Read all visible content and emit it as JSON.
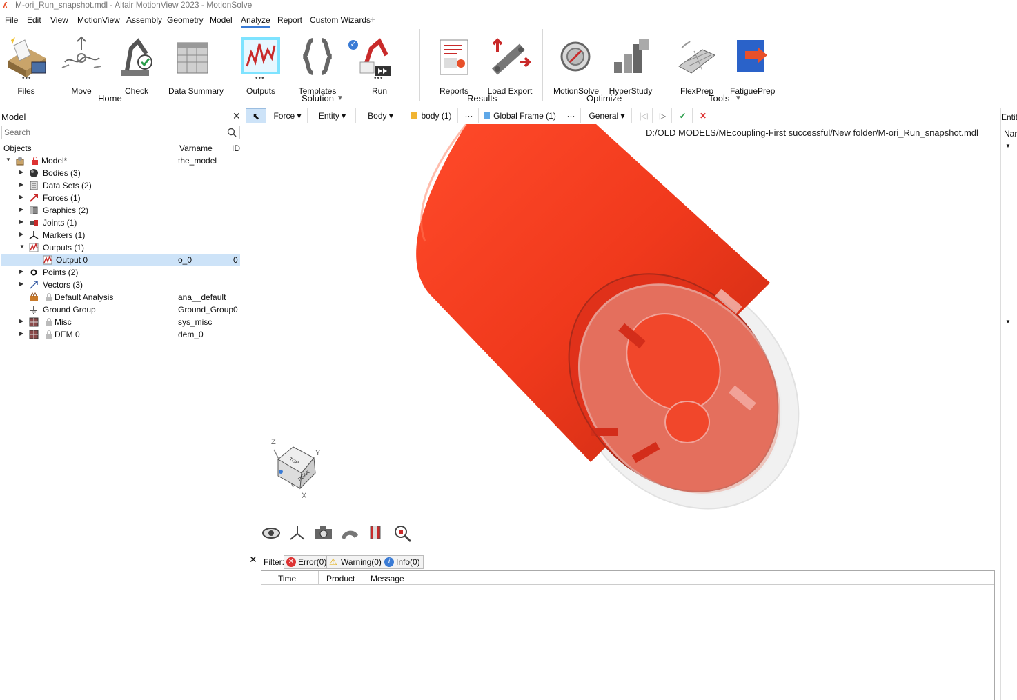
{
  "window": {
    "title": "M-ori_Run_snapshot.mdl - Altair MotionView 2023 - MotionSolve"
  },
  "menu": [
    "File",
    "Edit",
    "View",
    "MotionView",
    "Assembly",
    "Geometry",
    "Model",
    "Analyze",
    "Report",
    "Custom Wizards"
  ],
  "menu_active": "Analyze",
  "ribbon": {
    "tools": [
      "Files",
      "Move",
      "Check",
      "Data Summary",
      "Outputs",
      "Templates",
      "Run",
      "Reports",
      "Load Export",
      "MotionSolve",
      "HyperStudy",
      "FlexPrep",
      "FatiguePrep"
    ],
    "groups": [
      "Home",
      "Solution",
      "Results",
      "Optimize",
      "Tools"
    ]
  },
  "panel": {
    "title": "Model",
    "search_placeholder": "Search",
    "columns": [
      "Objects",
      "Varname",
      "ID"
    ],
    "rows": [
      {
        "name": "Model*",
        "varname": "the_model",
        "id": ""
      },
      {
        "name": "Bodies  (3)",
        "varname": "",
        "id": ""
      },
      {
        "name": "Data Sets  (2)",
        "varname": "",
        "id": ""
      },
      {
        "name": "Forces  (1)",
        "varname": "",
        "id": ""
      },
      {
        "name": "Graphics  (2)",
        "varname": "",
        "id": ""
      },
      {
        "name": "Joints  (1)",
        "varname": "",
        "id": ""
      },
      {
        "name": "Markers  (1)",
        "varname": "",
        "id": ""
      },
      {
        "name": "Outputs  (1)",
        "varname": "",
        "id": ""
      },
      {
        "name": "Output 0",
        "varname": "o_0",
        "id": "0"
      },
      {
        "name": "Points  (2)",
        "varname": "",
        "id": ""
      },
      {
        "name": "Vectors  (3)",
        "varname": "",
        "id": ""
      },
      {
        "name": "Default Analysis",
        "varname": "ana__default",
        "id": ""
      },
      {
        "name": "Ground Group",
        "varname": "Ground_Group",
        "id": "0"
      },
      {
        "name": "Misc",
        "varname": "sys_misc",
        "id": ""
      },
      {
        "name": "DEM 0",
        "varname": "dem_0",
        "id": ""
      }
    ]
  },
  "entity_toolbar": {
    "force": "Force",
    "entity": "Entity",
    "body": "Body",
    "body_value": "body (1)",
    "more1": "···",
    "frame_value": "Global Frame (1)",
    "more2": "···",
    "general": "General"
  },
  "viewport": {
    "filepath": "D:/OLD MODELS/MEcoupling-First successful/New folder/M-ori_Run_snapshot.mdl",
    "triad": {
      "z": "Z",
      "y": "Y",
      "x": "X"
    },
    "cube_faces": {
      "top": "TOP",
      "front": "REAR"
    }
  },
  "right_strip": {
    "label_top": "Entit",
    "label_name": "Nar"
  },
  "messages": {
    "filter_label": "Filter:",
    "error": "Error(0)",
    "warning": "Warning(0)",
    "info": "Info(0)",
    "columns": [
      "Time",
      "Product",
      "Message"
    ]
  },
  "colors": {
    "accent": "#3a7bd5",
    "selection": "#cde3f8",
    "body_red": "#ff3b1f"
  }
}
